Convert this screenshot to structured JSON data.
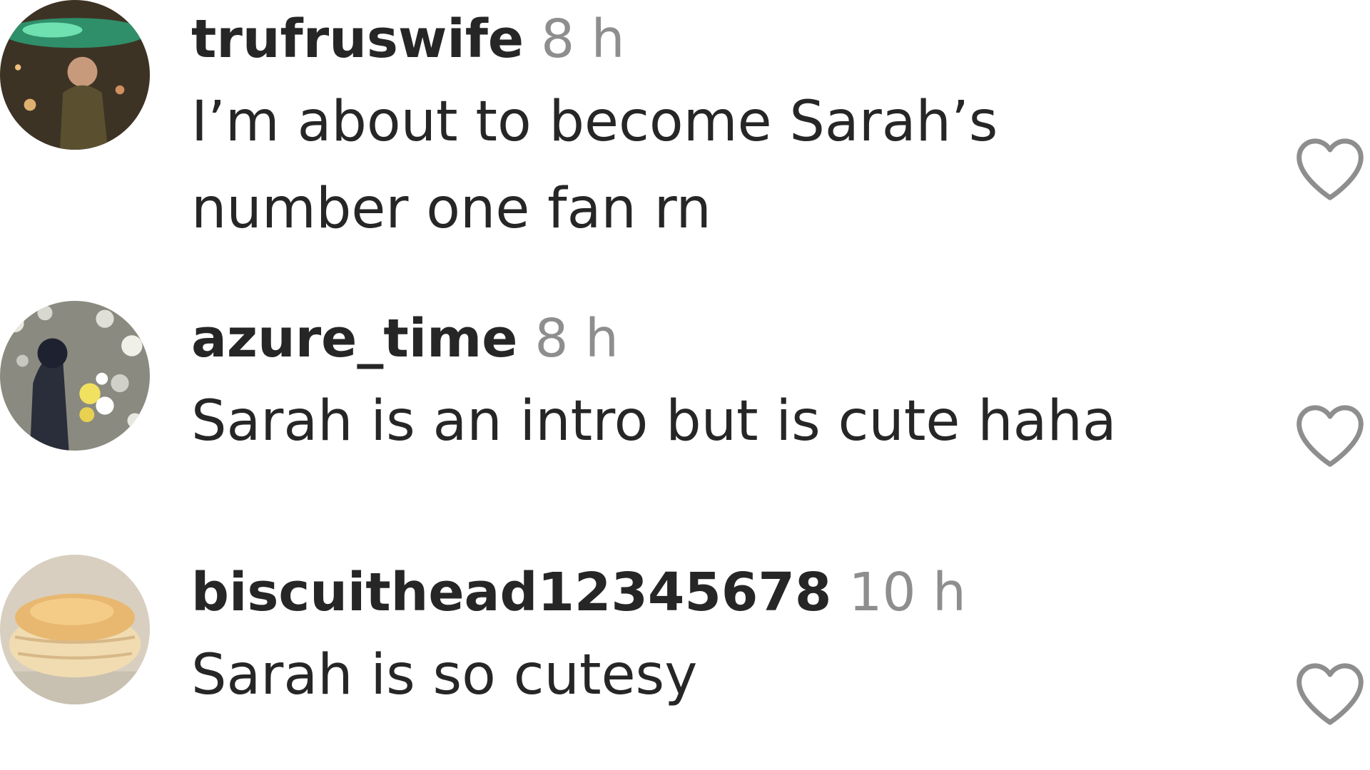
{
  "comments": [
    {
      "username": "trufruswife",
      "time": "8 h",
      "text": "I’m about to become Sarah’s number one fan rn",
      "avatar_icon": "profile-photo-concert",
      "like_icon": "heart-outline-icon"
    },
    {
      "username": "azure_time",
      "time": "8 h",
      "text": "Sarah is an intro but is cute haha",
      "avatar_icon": "profile-photo-flowers",
      "like_icon": "heart-outline-icon"
    },
    {
      "username": "biscuithead12345678",
      "time": "10 h",
      "text": "Sarah is so cutesy",
      "avatar_icon": "profile-photo-biscuit",
      "like_icon": "heart-outline-icon"
    }
  ],
  "colors": {
    "username": "#262626",
    "timestamp": "#8e8e8e",
    "heart_outline": "#8e8e8e"
  }
}
